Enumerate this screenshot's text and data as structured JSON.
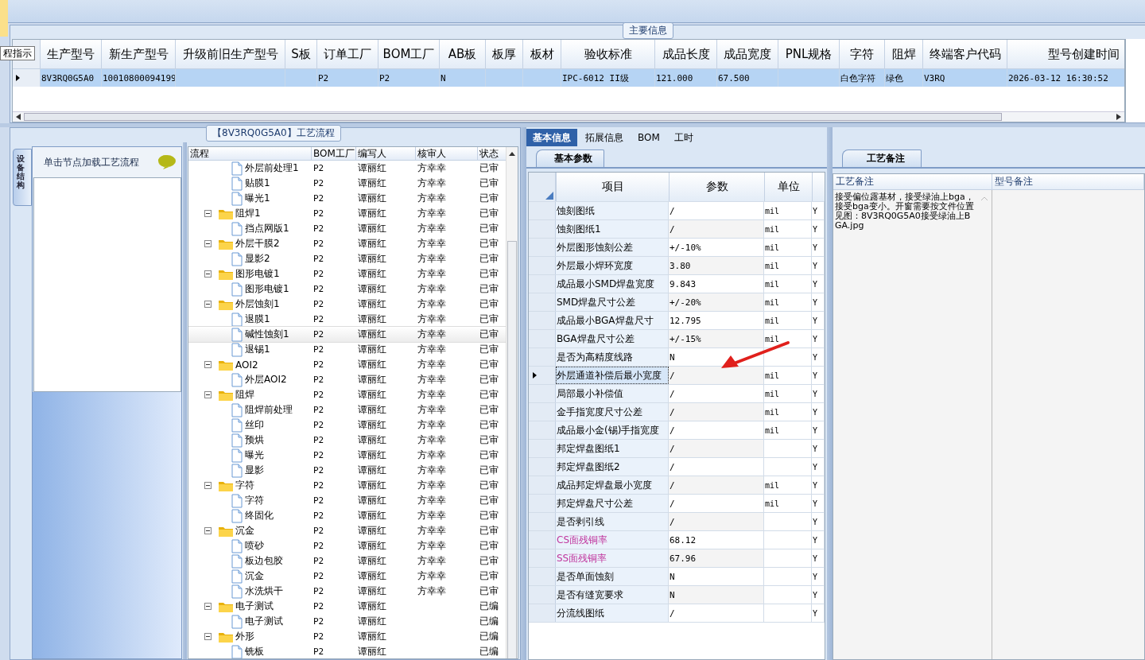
{
  "tooltip": "程指示",
  "main_info": {
    "title": "主要信息",
    "row_selected": true,
    "columns": [
      {
        "label": "生产型号",
        "value": "8V3RQ0G5A0"
      },
      {
        "label": "新生产型号",
        "value": "10010800094199"
      },
      {
        "label": "升级前旧生产型号"
      },
      {
        "label": "S板"
      },
      {
        "label": "订单工厂",
        "value": "P2"
      },
      {
        "label": "BOM工厂",
        "value": "P2"
      },
      {
        "label": "AB板",
        "value": "N"
      },
      {
        "label": "板厚"
      },
      {
        "label": "板材"
      },
      {
        "label": "验收标准",
        "value": "IPC-6012 II级"
      },
      {
        "label": "成品长度",
        "value": "121.000"
      },
      {
        "label": "成品宽度",
        "value": "67.500"
      },
      {
        "label": "PNL规格"
      },
      {
        "label": "字符",
        "value": "白色字符"
      },
      {
        "label": "阻焊",
        "value": "绿色"
      },
      {
        "label": "终端客户代码",
        "value": "V3RQ"
      },
      {
        "label": "型号创建时间",
        "value": "2026-03-12 16:30:52"
      }
    ]
  },
  "flow": {
    "title": "【8V3RQ0G5A0】工艺流程",
    "side_tab": "设备结构",
    "hint": "单击节点加载工艺流程",
    "columns": [
      "流程",
      "BOM工厂",
      "编写人",
      "核审人",
      "状态"
    ],
    "nodes": [
      {
        "kind": "step",
        "name": "外层前处理1",
        "bom": "P2",
        "writer": "谭丽红",
        "reviewer": "方幸幸",
        "status": "已审",
        "selected": false
      },
      {
        "kind": "step",
        "name": "贴膜1",
        "bom": "P2",
        "writer": "谭丽红",
        "reviewer": "方幸幸",
        "status": "已审",
        "selected": false
      },
      {
        "kind": "step",
        "name": "曝光1",
        "bom": "P2",
        "writer": "谭丽红",
        "reviewer": "方幸幸",
        "status": "已审",
        "selected": false
      },
      {
        "kind": "group",
        "name": "阻焊1",
        "bom": "P2",
        "writer": "谭丽红",
        "reviewer": "方幸幸",
        "status": "已审",
        "selected": false,
        "expanded": true,
        "children": [
          {
            "kind": "step",
            "name": "挡点网版1",
            "bom": "P2",
            "writer": "谭丽红",
            "reviewer": "方幸幸",
            "status": "已审",
            "selected": false
          }
        ]
      },
      {
        "kind": "group",
        "name": "外层干膜2",
        "bom": "P2",
        "writer": "谭丽红",
        "reviewer": "方幸幸",
        "status": "已审",
        "selected": false,
        "expanded": true,
        "children": [
          {
            "kind": "step",
            "name": "显影2",
            "bom": "P2",
            "writer": "谭丽红",
            "reviewer": "方幸幸",
            "status": "已审",
            "selected": false
          }
        ]
      },
      {
        "kind": "group",
        "name": "图形电镀1",
        "bom": "P2",
        "writer": "谭丽红",
        "reviewer": "方幸幸",
        "status": "已审",
        "selected": false,
        "expanded": true,
        "children": [
          {
            "kind": "step",
            "name": "图形电镀1",
            "bom": "P2",
            "writer": "谭丽红",
            "reviewer": "方幸幸",
            "status": "已审",
            "selected": false
          }
        ]
      },
      {
        "kind": "group",
        "name": "外层蚀刻1",
        "bom": "P2",
        "writer": "谭丽红",
        "reviewer": "方幸幸",
        "status": "已审",
        "selected": false,
        "expanded": true,
        "children": [
          {
            "kind": "step",
            "name": "退膜1",
            "bom": "P2",
            "writer": "谭丽红",
            "reviewer": "方幸幸",
            "status": "已审",
            "selected": false
          },
          {
            "kind": "step",
            "name": "碱性蚀刻1",
            "bom": "P2",
            "writer": "谭丽红",
            "reviewer": "方幸幸",
            "status": "已审",
            "selected": true
          },
          {
            "kind": "step",
            "name": "退锡1",
            "bom": "P2",
            "writer": "谭丽红",
            "reviewer": "方幸幸",
            "status": "已审",
            "selected": false
          }
        ]
      },
      {
        "kind": "group",
        "name": "AOI2",
        "bom": "P2",
        "writer": "谭丽红",
        "reviewer": "方幸幸",
        "status": "已审",
        "selected": false,
        "expanded": true,
        "children": [
          {
            "kind": "step",
            "name": "外层AOI2",
            "bom": "P2",
            "writer": "谭丽红",
            "reviewer": "方幸幸",
            "status": "已审",
            "selected": false
          }
        ]
      },
      {
        "kind": "group",
        "name": "阻焊",
        "bom": "P2",
        "writer": "谭丽红",
        "reviewer": "方幸幸",
        "status": "已审",
        "selected": false,
        "expanded": true,
        "children": [
          {
            "kind": "step",
            "name": "阻焊前处理",
            "bom": "P2",
            "writer": "谭丽红",
            "reviewer": "方幸幸",
            "status": "已审",
            "selected": false
          },
          {
            "kind": "step",
            "name": "丝印",
            "bom": "P2",
            "writer": "谭丽红",
            "reviewer": "方幸幸",
            "status": "已审",
            "selected": false
          },
          {
            "kind": "step",
            "name": "预烘",
            "bom": "P2",
            "writer": "谭丽红",
            "reviewer": "方幸幸",
            "status": "已审",
            "selected": false
          },
          {
            "kind": "step",
            "name": "曝光",
            "bom": "P2",
            "writer": "谭丽红",
            "reviewer": "方幸幸",
            "status": "已审",
            "selected": false
          },
          {
            "kind": "step",
            "name": "显影",
            "bom": "P2",
            "writer": "谭丽红",
            "reviewer": "方幸幸",
            "status": "已审",
            "selected": false
          }
        ]
      },
      {
        "kind": "group",
        "name": "字符",
        "bom": "P2",
        "writer": "谭丽红",
        "reviewer": "方幸幸",
        "status": "已审",
        "selected": false,
        "expanded": true,
        "children": [
          {
            "kind": "step",
            "name": "字符",
            "bom": "P2",
            "writer": "谭丽红",
            "reviewer": "方幸幸",
            "status": "已审",
            "selected": false
          },
          {
            "kind": "step",
            "name": "终固化",
            "bom": "P2",
            "writer": "谭丽红",
            "reviewer": "方幸幸",
            "status": "已审",
            "selected": false
          }
        ]
      },
      {
        "kind": "group",
        "name": "沉金",
        "bom": "P2",
        "writer": "谭丽红",
        "reviewer": "方幸幸",
        "status": "已审",
        "selected": false,
        "expanded": true,
        "children": [
          {
            "kind": "step",
            "name": "喷砂",
            "bom": "P2",
            "writer": "谭丽红",
            "reviewer": "方幸幸",
            "status": "已审",
            "selected": false
          },
          {
            "kind": "step",
            "name": "板边包胶",
            "bom": "P2",
            "writer": "谭丽红",
            "reviewer": "方幸幸",
            "status": "已审",
            "selected": false
          },
          {
            "kind": "step",
            "name": "沉金",
            "bom": "P2",
            "writer": "谭丽红",
            "reviewer": "方幸幸",
            "status": "已审",
            "selected": false
          },
          {
            "kind": "step",
            "name": "水洗烘干",
            "bom": "P2",
            "writer": "谭丽红",
            "reviewer": "方幸幸",
            "status": "已审",
            "selected": false
          }
        ]
      },
      {
        "kind": "group",
        "name": "电子测试",
        "bom": "P2",
        "writer": "谭丽红",
        "status": "已编",
        "selected": false,
        "expanded": true,
        "children": [
          {
            "kind": "step",
            "name": "电子测试",
            "bom": "P2",
            "writer": "谭丽红",
            "status": "已编",
            "selected": false
          }
        ]
      },
      {
        "kind": "group",
        "name": "外形",
        "bom": "P2",
        "writer": "谭丽红",
        "status": "已编",
        "selected": false,
        "expanded": true,
        "children": [
          {
            "kind": "step",
            "name": "铣板",
            "bom": "P2",
            "writer": "谭丽红",
            "status": "已编",
            "selected": false
          }
        ]
      }
    ]
  },
  "detail": {
    "tabs": [
      {
        "label": "基本信息",
        "selected": true
      },
      {
        "label": "拓展信息",
        "selected": false
      },
      {
        "label": "BOM",
        "selected": false
      },
      {
        "label": "工时",
        "selected": false
      }
    ],
    "subtab": "基本参数",
    "columns": [
      "项目",
      "参数",
      "单位"
    ],
    "rows": [
      {
        "item": "蚀刻图纸",
        "value": "/",
        "unit": "mil",
        "flag": "Y",
        "selected": false
      },
      {
        "item": "蚀刻图纸1",
        "value": "/",
        "unit": "mil",
        "flag": "Y",
        "selected": false
      },
      {
        "item": "外层图形蚀刻公差",
        "value": "+/-10%",
        "unit": "mil",
        "flag": "Y",
        "selected": false
      },
      {
        "item": "外层最小焊环宽度",
        "value": "3.80",
        "unit": "mil",
        "flag": "Y",
        "selected": false
      },
      {
        "item": "成品最小SMD焊盘宽度",
        "value": "9.843",
        "unit": "mil",
        "flag": "Y",
        "selected": false
      },
      {
        "item": "SMD焊盘尺寸公差",
        "value": "+/-20%",
        "unit": "mil",
        "flag": "Y",
        "selected": false
      },
      {
        "item": "成品最小BGA焊盘尺寸",
        "value": "12.795",
        "unit": "mil",
        "flag": "Y",
        "selected": false
      },
      {
        "item": "BGA焊盘尺寸公差",
        "value": "+/-15%",
        "unit": "mil",
        "flag": "Y",
        "selected": false
      },
      {
        "item": "是否为高精度线路",
        "value": "N",
        "flag": "Y",
        "selected": false
      },
      {
        "item": "外层通道补偿后最小宽度",
        "value": "/",
        "unit": "mil",
        "flag": "Y",
        "selected": true
      },
      {
        "item": "局部最小补偿值",
        "value": "/",
        "unit": "mil",
        "flag": "Y",
        "selected": false
      },
      {
        "item": "金手指宽度尺寸公差",
        "value": "/",
        "unit": "mil",
        "flag": "Y",
        "selected": false
      },
      {
        "item": "成品最小金(锡)手指宽度",
        "value": "/",
        "unit": "mil",
        "flag": "Y",
        "selected": false
      },
      {
        "item": "邦定焊盘图纸1",
        "value": "/",
        "flag": "Y",
        "selected": false
      },
      {
        "item": "邦定焊盘图纸2",
        "value": "/",
        "flag": "Y",
        "selected": false
      },
      {
        "item": "成品邦定焊盘最小宽度",
        "value": "/",
        "unit": "mil",
        "flag": "Y",
        "selected": false
      },
      {
        "item": "邦定焊盘尺寸公差",
        "value": "/",
        "unit": "mil",
        "flag": "Y",
        "selected": false
      },
      {
        "item": "是否剥引线",
        "value": "/",
        "flag": "Y",
        "selected": false
      },
      {
        "item": "CS面残铜率",
        "value": "68.12",
        "flag": "Y",
        "selected": false,
        "color": "#c0369e"
      },
      {
        "item": "SS面残铜率",
        "value": "67.96",
        "flag": "Y",
        "selected": false,
        "color": "#c0369e"
      },
      {
        "item": "是否单面蚀刻",
        "value": "N",
        "flag": "Y",
        "selected": false
      },
      {
        "item": "是否有缝宽要求",
        "value": "N",
        "flag": "Y",
        "selected": false
      },
      {
        "item": "分流线图纸",
        "value": "/",
        "flag": "Y",
        "selected": false
      }
    ]
  },
  "notes": {
    "tab": "工艺备注",
    "columns": [
      "工艺备注",
      "型号备注"
    ],
    "process_note": "接受偏位露基材，接受绿油上bga，接受bga变小。开窗需要按文件位置见图：8V3RQ0G5A0接受绿油上BGA.jpg"
  }
}
